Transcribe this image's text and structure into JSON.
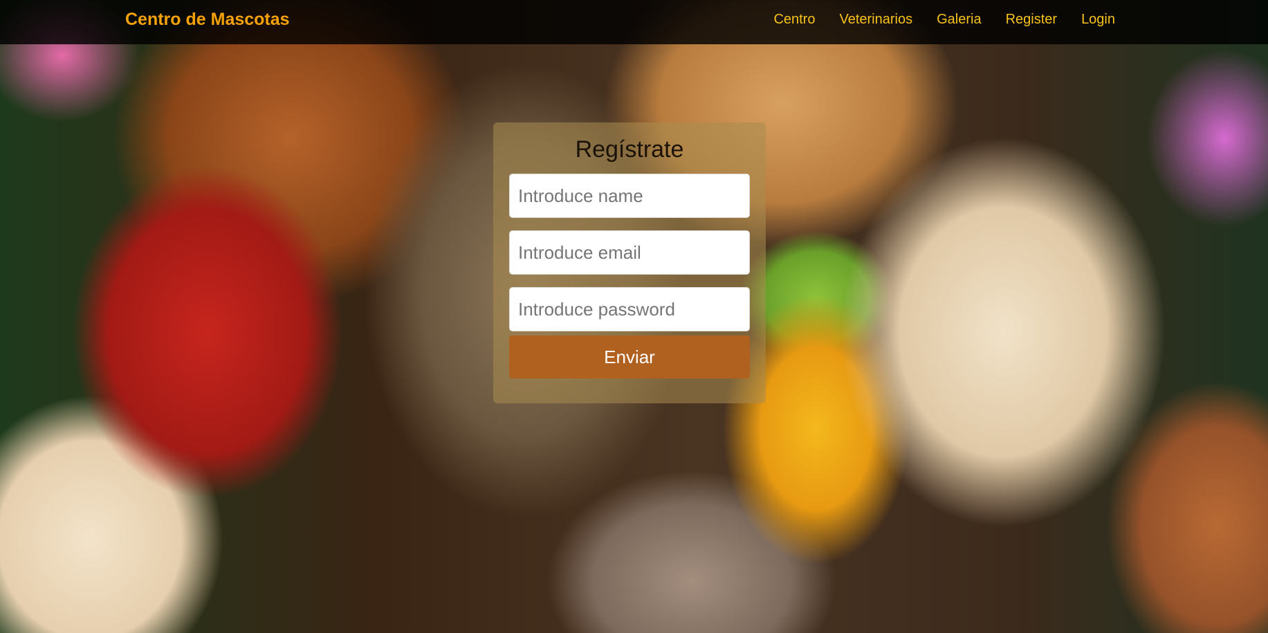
{
  "nav": {
    "brand": "Centro de Mascotas",
    "links": [
      "Centro",
      "Veterinarios",
      "Galeria",
      "Register",
      "Login"
    ]
  },
  "form": {
    "title": "Regístrate",
    "name_placeholder": "Introduce name",
    "email_placeholder": "Introduce email",
    "password_placeholder": "Introduce password",
    "submit_label": "Enviar"
  },
  "colors": {
    "brand": "#f5a20a",
    "nav_link": "#f7c21b",
    "button": "#b06120"
  },
  "background": "photo of pets: dogs, cat, parrots, rabbits"
}
